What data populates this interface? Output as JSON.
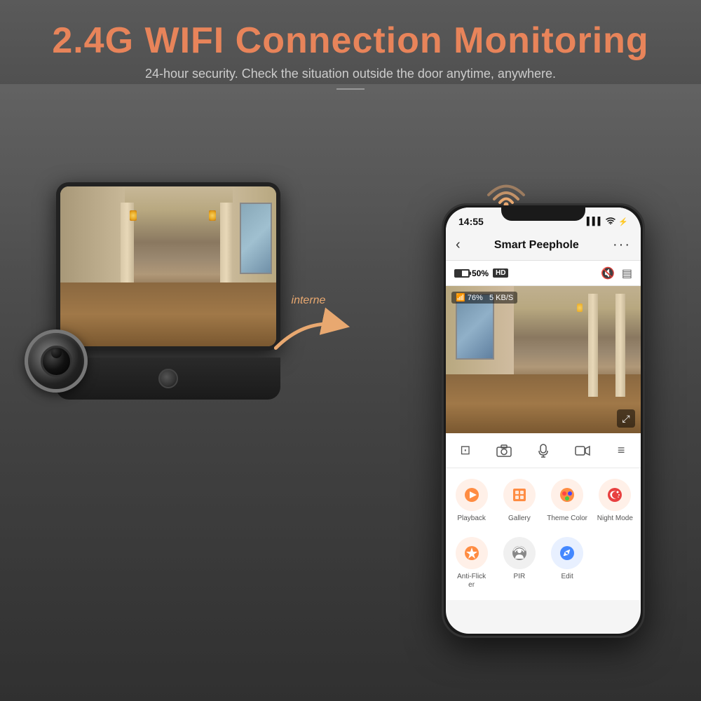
{
  "header": {
    "title": "2.4G WIFI Connection Monitoring",
    "subtitle": "24-hour security. Check the situation outside the door anytime, anywhere."
  },
  "arrow": {
    "label": "interne"
  },
  "phone": {
    "status_bar": {
      "time": "14:55",
      "signal": "▌▌▌",
      "wifi": "WiFi",
      "battery": "⚡"
    },
    "app_header": {
      "title": "Smart Peephole",
      "back": "‹",
      "more": "···"
    },
    "cam_info": {
      "battery_pct": "50%",
      "hd": "HD",
      "signal_pct": "76%",
      "speed": "5 KB/S"
    },
    "controls": [
      "⊡",
      "📷",
      "🎤",
      "▷",
      "≡"
    ],
    "features_row1": [
      {
        "label": "Playback",
        "icon": "▶",
        "color": "orange"
      },
      {
        "label": "Gallery",
        "icon": "🖼",
        "color": "orange"
      },
      {
        "label": "Theme\nColor",
        "icon": "🎨",
        "color": "orange"
      },
      {
        "label": "Night\nMode",
        "icon": "☽",
        "color": "red-orange"
      }
    ],
    "features_row2": [
      {
        "label": "Anti-Flicker",
        "icon": "⚡",
        "color": "orange"
      },
      {
        "label": "PIR",
        "icon": "👁",
        "color": "gray"
      },
      {
        "label": "Edit",
        "icon": "✏",
        "color": "blue"
      },
      {
        "label": "",
        "icon": "",
        "color": "gray"
      }
    ]
  }
}
